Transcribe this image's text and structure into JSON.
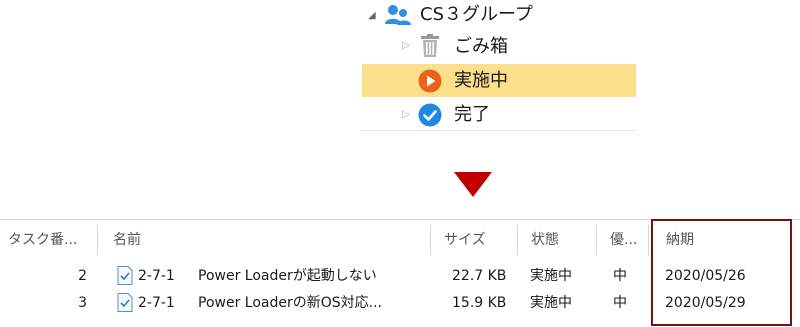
{
  "tree": {
    "group_label": "CS３グループ",
    "items": [
      {
        "label": "ごみ箱",
        "icon": "trash-icon"
      },
      {
        "label": "実施中",
        "icon": "play-circle-icon",
        "selected": true
      },
      {
        "label": "完了",
        "icon": "check-circle-icon"
      }
    ]
  },
  "table": {
    "headers": {
      "task_no": "タスク番...",
      "name": "名前",
      "size": "サイズ",
      "status": "状態",
      "priority": "優...",
      "due": "納期"
    },
    "rows": [
      {
        "task_no": "2",
        "code": "2-7-1",
        "title": "Power Loaderが起動しない",
        "size": "22.7 KB",
        "status": "実施中",
        "priority": "中",
        "due": "2020/05/26"
      },
      {
        "task_no": "3",
        "code": "2-7-1",
        "title": "Power Loaderの新OS対応...",
        "size": "15.9 KB",
        "status": "実施中",
        "priority": "中",
        "due": "2020/05/29"
      }
    ]
  },
  "colors": {
    "selection": "#fbdf8a",
    "arrow": "#c00000",
    "highlight_border": "#7a1010",
    "play_icon": "#e8641b",
    "check_icon": "#1e88e5",
    "group_icon": "#2f8fe0"
  }
}
